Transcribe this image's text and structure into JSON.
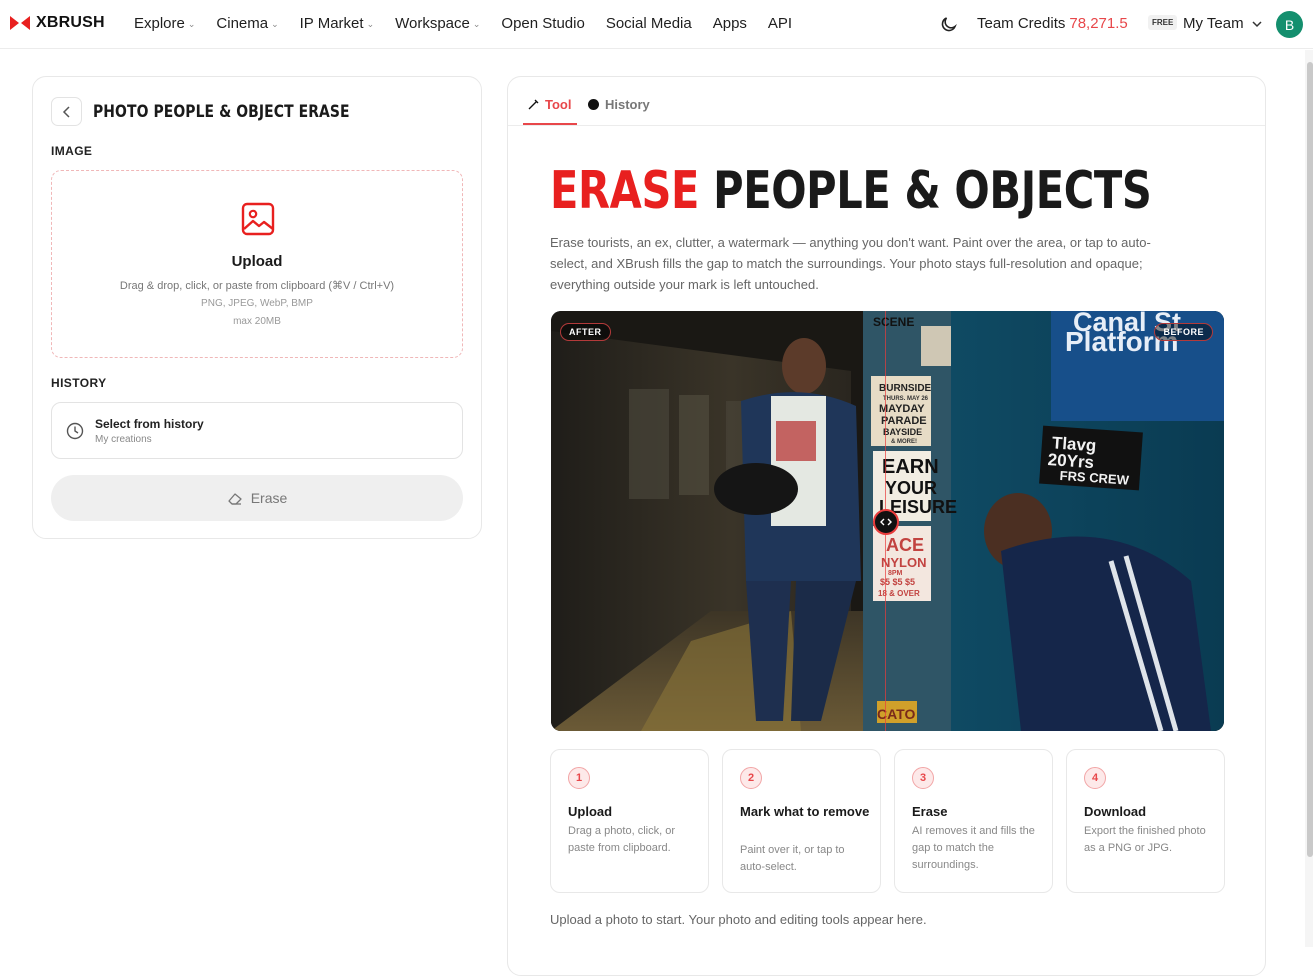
{
  "brand": {
    "name": "XBRUSH",
    "accent": "#e8201f"
  },
  "nav": {
    "items": [
      {
        "label": "Explore",
        "dropdown": true
      },
      {
        "label": "Cinema",
        "dropdown": true
      },
      {
        "label": "IP Market",
        "dropdown": true
      },
      {
        "label": "Workspace",
        "dropdown": true
      },
      {
        "label": "Open Studio",
        "dropdown": false
      },
      {
        "label": "Social Media",
        "dropdown": false
      },
      {
        "label": "Apps",
        "dropdown": false
      },
      {
        "label": "API",
        "dropdown": false
      }
    ],
    "credits_label": "Team Credits",
    "credits_value": "78,271.5",
    "plan_badge": "FREE",
    "team_label": "My Team",
    "avatar_initial": "B"
  },
  "left_panel": {
    "title": "PHOTO PEOPLE & OBJECT ERASE",
    "image_label": "IMAGE",
    "upload": {
      "title": "Upload",
      "subtitle": "Drag & drop, click, or paste from clipboard (⌘V / Ctrl+V)",
      "types": "PNG, JPEG, WebP, BMP",
      "max": "max 20MB"
    },
    "history_label": "HISTORY",
    "history_select": {
      "title": "Select from history",
      "subtitle": "My creations"
    },
    "erase_button": "Erase"
  },
  "right_panel": {
    "tabs": [
      {
        "label": "Tool",
        "active": true
      },
      {
        "label": "History",
        "active": false
      }
    ],
    "hero_red": "ERASE",
    "hero_rest": " PEOPLE & OBJECTS",
    "description": "Erase tourists, an ex, clutter, a watermark — anything you don't want. Paint over the area, or tap to auto-select, and XBrush fills the gap to match the surroundings. Your photo stays full-resolution and opaque; everything outside your mark is left untouched.",
    "compare": {
      "after_label": "AFTER",
      "before_label": "BEFORE",
      "slider_position": 0.5
    },
    "photo_texts": {
      "scene": "SCENE",
      "burnside": "BURNSIDE",
      "may": "THURS. MAY 26",
      "mayday": "MAYDAY",
      "parade": "PARADE",
      "bayside": "BAYSIDE",
      "more": "& MORE!",
      "earn": "EARN",
      "your": "YOUR",
      "leisure": "LEISURE",
      "ace": "ACE",
      "nylon": "NYLON",
      "pm": "8PM",
      "price": "$5 $5 $5",
      "over": "18 & OVER",
      "cato": "CATO",
      "canal": "Canal St",
      "platform": "Platform",
      "tlavg": "Tlavg",
      "years": "20Yrs",
      "crew": "FRS CREW"
    },
    "steps": [
      {
        "num": "1",
        "title": "Upload",
        "desc": "Drag a photo, click, or paste from clipboard."
      },
      {
        "num": "2",
        "title": "Mark what to remove",
        "desc": "Paint over it, or tap to auto-select."
      },
      {
        "num": "3",
        "title": "Erase",
        "desc": "AI removes it and fills the gap to match the surroundings."
      },
      {
        "num": "4",
        "title": "Download",
        "desc": "Export the finished photo as a PNG or JPG."
      }
    ],
    "footer_note": "Upload a photo to start. Your photo and editing tools appear here."
  }
}
